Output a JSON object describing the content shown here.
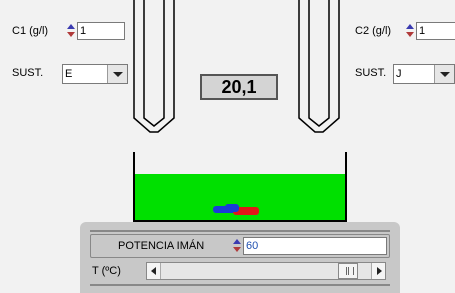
{
  "left_controls": {
    "c1_label": "C1 (g/l)",
    "c1_value": "1",
    "sust_label": "SUST.",
    "sust_value": "E"
  },
  "right_controls": {
    "c2_label": "C2 (g/l)",
    "c2_value": "1",
    "sust_label": "SUST.",
    "sust_value": "J"
  },
  "readout": "20,1",
  "bottom_panel": {
    "power_label": "POTENCIA IMÁN",
    "power_value": "60",
    "temp_label": "T (ºC)",
    "temp_slider_fraction": 0.93
  },
  "colors": {
    "liquid": "#00e000",
    "magnet_blue": "#1a3cd8",
    "magnet_red": "#e01818",
    "panel": "#c8c8c8"
  }
}
